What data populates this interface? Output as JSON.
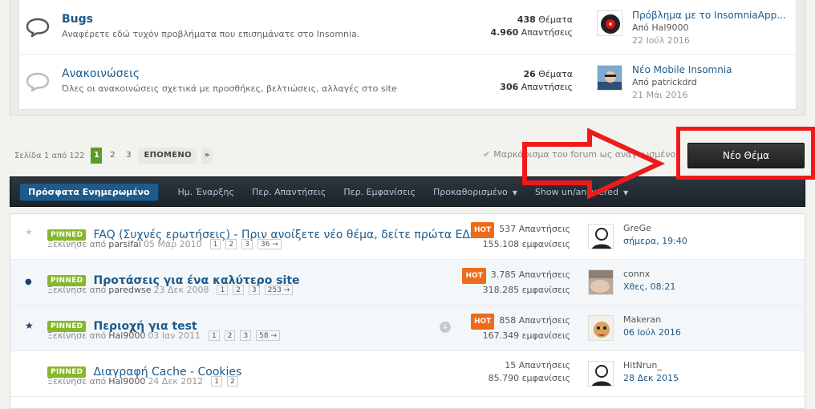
{
  "forums": [
    {
      "title": "Bugs",
      "description": "Αναφέρετε εδώ τυχόν προβλήματα που επισημάνατε στο Insomnia.",
      "topics": "438",
      "topics_label": "Θέματα",
      "replies": "4.960",
      "replies_label": "Απαντήσεις",
      "last_post_title": "Πρόβλημα με το InsomniaApp...",
      "last_post_by_prefix": "Από",
      "last_post_author": "Hal9000",
      "last_post_date": "22 Ιούλ 2016"
    },
    {
      "title": "Ανακοινώσεις",
      "description": "Όλες οι ανακοινώσεις σχετικά με προσθήκες, βελτιώσεις, αλλαγές στο site",
      "topics": "26",
      "topics_label": "Θέματα",
      "replies": "306",
      "replies_label": "Απαντήσεις",
      "last_post_title": "Νέο Mobile Insomnia",
      "last_post_by_prefix": "Από",
      "last_post_author": "patrickdrd",
      "last_post_date": "21 Μάι 2016"
    }
  ],
  "pagination": {
    "label": "Σελίδα 1 από 122",
    "pages": [
      "1",
      "2",
      "3"
    ],
    "next": "ΕΠΟΜΕΝΟ",
    "last": "»"
  },
  "mark_read": "Μαρκάρισμα του forum ως αναγνωσμένο",
  "new_topic": "Νέο Θέμα",
  "filters": {
    "recent": "Πρόσφατα Ενημερωμένο",
    "start_date": "Ημ. Έναρξης",
    "replies": "Περ. Απαντήσεις",
    "views": "Περ. Εμφανίσεις",
    "default": "Προκαθορισμένο",
    "show_answered": "Show un/answered"
  },
  "topics": [
    {
      "pinned": "PINNED",
      "title": "FAQ (Συχνές ερωτήσεις) - Πριν ανοίξετε νέο θέμα, δείτε πρώτα ΕΔΩ!",
      "started_by": "Ξεκίνησε από",
      "author": "parsifal",
      "date": "05 Μάρ 2010",
      "pages": [
        "1",
        "2",
        "3",
        "36 →"
      ],
      "hot": "HOT",
      "replies": "537 Απαντήσεις",
      "views": "155.108 εμφανίσεις",
      "last_author": "GreGe",
      "last_time": "σήμερα, 19:40"
    },
    {
      "pinned": "PINNED",
      "title": "Προτάσεις για ένα καλύτερο site",
      "started_by": "Ξεκίνησε από",
      "author": "paredwse",
      "date": "23 Δεκ 2008",
      "pages": [
        "1",
        "2",
        "3",
        "253 →"
      ],
      "hot": "HOT",
      "replies": "3.785 Απαντήσεις",
      "views": "318.285 εμφανίσεις",
      "last_author": "connx",
      "last_time": "Χθες, 08:21"
    },
    {
      "pinned": "PINNED",
      "title": "Περιοχή για test",
      "started_by": "Ξεκίνησε από",
      "author": "Hal9000",
      "date": "03 Ιαν 2011",
      "pages": [
        "1",
        "2",
        "3",
        "58 →"
      ],
      "hot": "HOT",
      "replies": "858 Απαντήσεις",
      "views": "167.349 εμφανίσεις",
      "last_author": "Makeran",
      "last_time": "06 Ιούλ 2016"
    },
    {
      "pinned": "PINNED",
      "title": "Διαγραφή Cache - Cookies",
      "started_by": "Ξεκίνησε από",
      "author": "Hal9000",
      "date": "24 Δεκ 2012",
      "pages": [
        "1",
        "2"
      ],
      "hot": "",
      "replies": "15 Απαντήσεις",
      "views": "85.790 εμφανίσεις",
      "last_author": "HitNrun_",
      "last_time": "28 Δεκ 2015"
    }
  ],
  "colors": {
    "link": "#1c5a8c",
    "pinned": "#86b82a",
    "hot": "#f06a1a",
    "annotation": "#ef1a1a"
  }
}
